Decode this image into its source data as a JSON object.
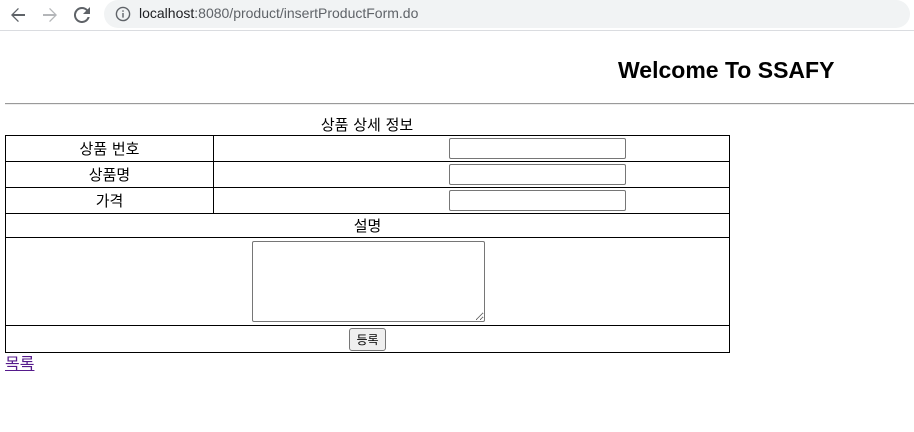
{
  "browser": {
    "url_host": "localhost",
    "url_path": ":8080/product/insertProductForm.do",
    "back_icon": "arrow-left-icon",
    "forward_icon": "arrow-right-icon",
    "reload_icon": "reload-icon",
    "info_icon": "info-icon"
  },
  "page": {
    "heading": "Welcome To SSAFY",
    "table_caption": "상품 상세 정보",
    "fields": [
      {
        "label": "상품 번호",
        "value": ""
      },
      {
        "label": "상품명",
        "value": ""
      },
      {
        "label": "가격",
        "value": ""
      }
    ],
    "description_label": "설명",
    "description_value": "",
    "submit_label": "등록",
    "list_link": "목록"
  },
  "colors": {
    "link_visited": "#551a8b",
    "omnibox_bg": "#f1f3f4"
  }
}
